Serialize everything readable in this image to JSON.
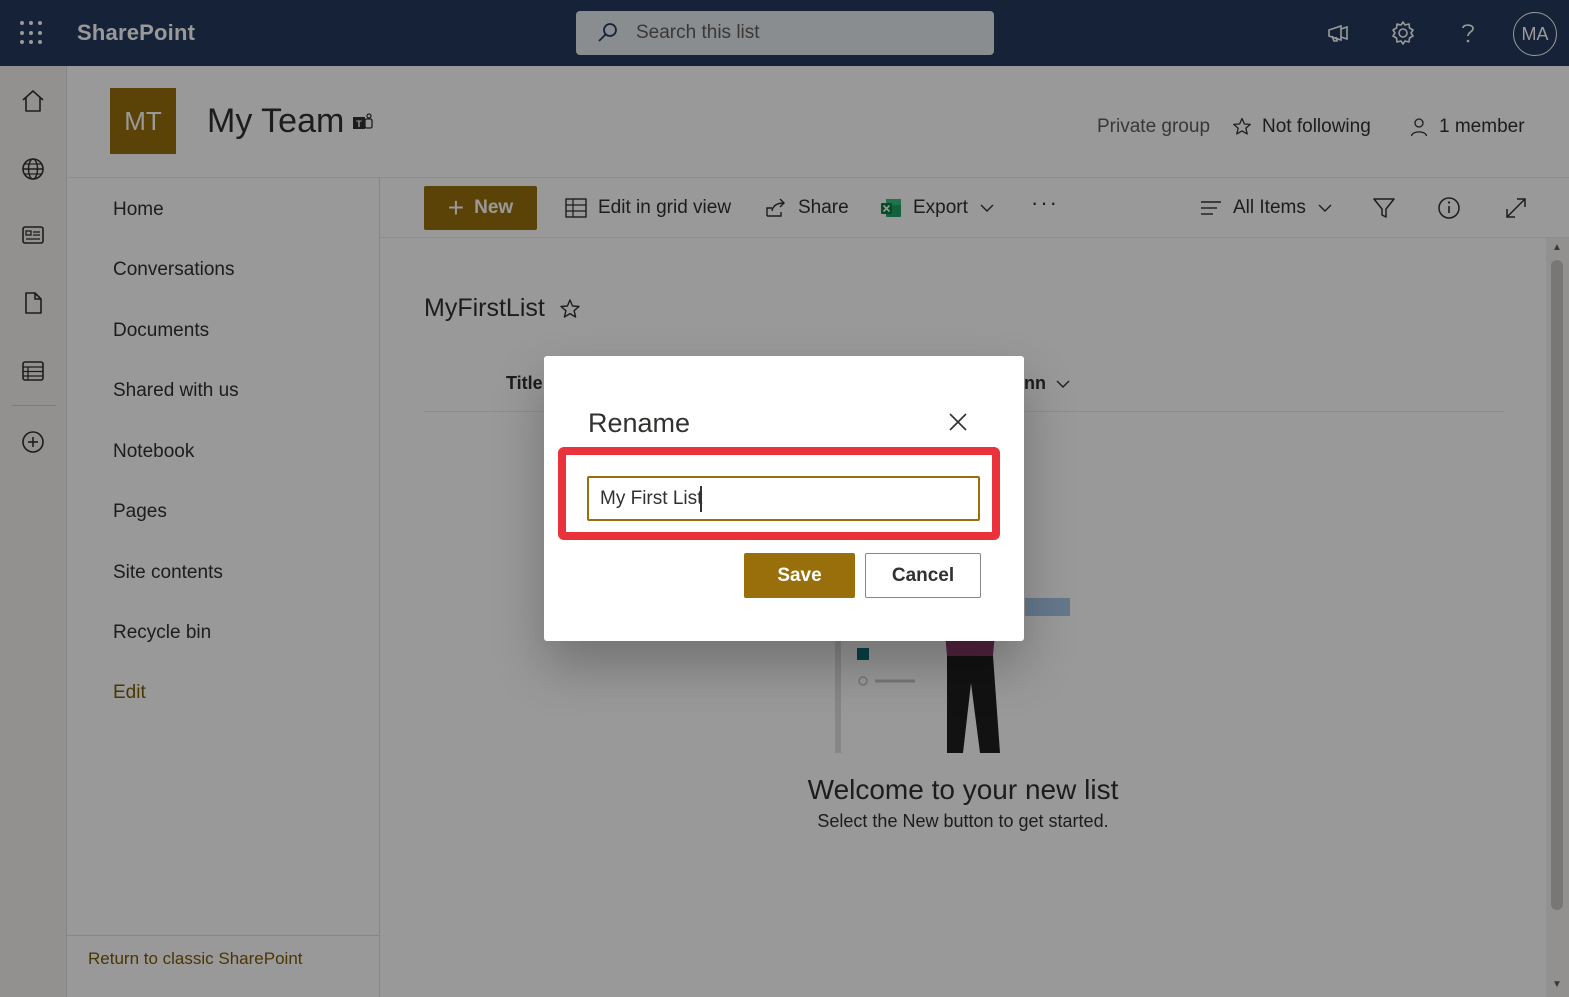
{
  "suitebar": {
    "app_name": "SharePoint",
    "search_placeholder": "Search this list",
    "avatar_initials": "MA"
  },
  "site": {
    "logo_initials": "MT",
    "title": "My Team",
    "privacy": "Private group",
    "follow_label": "Not following",
    "members_label": "1 member",
    "logo_color": "#986f0b"
  },
  "nav": {
    "items": [
      "Home",
      "Conversations",
      "Documents",
      "Shared with us",
      "Notebook",
      "Pages",
      "Site contents",
      "Recycle bin"
    ],
    "edit_label": "Edit",
    "classic_link": "Return to classic SharePoint"
  },
  "commandbar": {
    "new_label": "New",
    "grid_label": "Edit in grid view",
    "share_label": "Share",
    "export_label": "Export",
    "view_label": "All Items"
  },
  "list": {
    "title": "MyFirstList",
    "col_title": "Title",
    "col_add": "nn",
    "welcome_heading": "Welcome to your new list",
    "welcome_sub": "Select the New button to get started."
  },
  "dialog": {
    "title": "Rename",
    "input_value": "My First List",
    "save_label": "Save",
    "cancel_label": "Cancel"
  },
  "colors": {
    "suitebar": "#243a5e",
    "accent": "#986f0b",
    "highlight": "#e9323b"
  }
}
